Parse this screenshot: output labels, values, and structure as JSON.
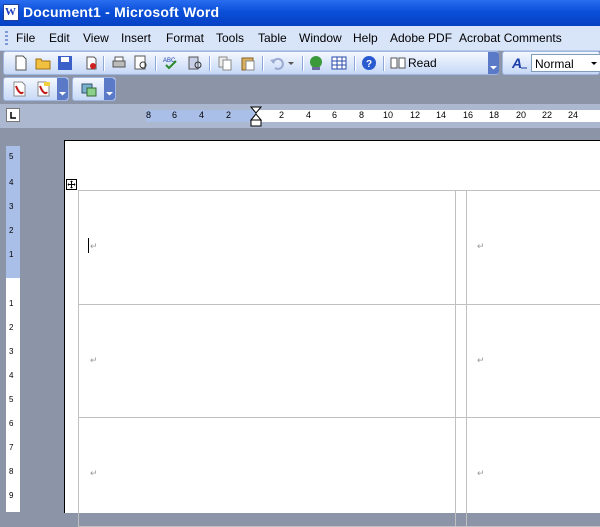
{
  "window": {
    "title": "Document1 - Microsoft Word",
    "app_icon": "word-icon"
  },
  "menu": [
    "File",
    "Edit",
    "View",
    "Insert",
    "Format",
    "Tools",
    "Table",
    "Window",
    "Help",
    "Adobe PDF",
    "Acrobat Comments"
  ],
  "toolbar": {
    "read_label": "Read",
    "style_value": "Normal"
  },
  "ruler": {
    "h_ticks": [
      "8",
      "6",
      "4",
      "2",
      "2",
      "4",
      "6",
      "8",
      "10",
      "12",
      "14",
      "16",
      "18",
      "20",
      "22",
      "24"
    ],
    "v_ticks": [
      "5",
      "4",
      "3",
      "2",
      "1",
      "1",
      "2",
      "3",
      "4",
      "5",
      "6",
      "7",
      "8",
      "9"
    ]
  },
  "document": {
    "paragraph_mark": "↵"
  }
}
